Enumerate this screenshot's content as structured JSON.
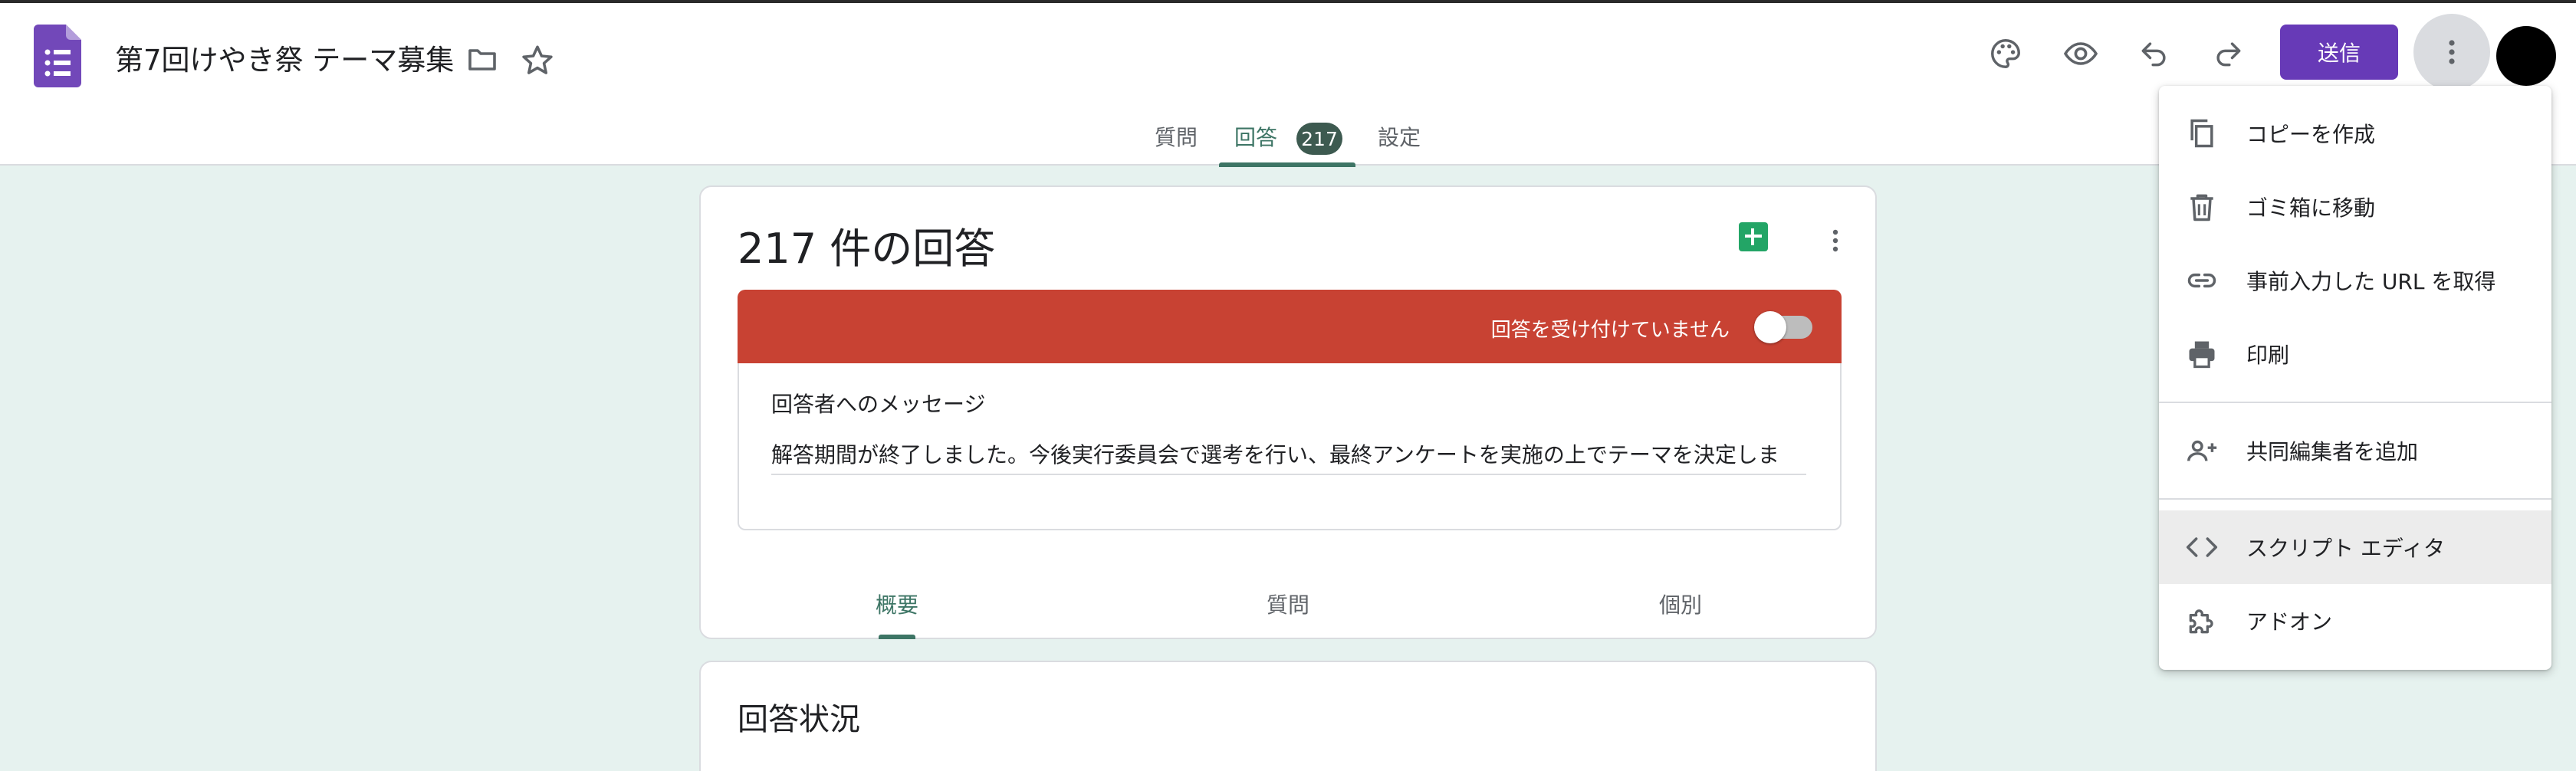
{
  "form": {
    "title": "第7回けやき祭 テーマ募集",
    "send_label": "送信"
  },
  "tabs": {
    "questions": "質問",
    "responses": "回答",
    "responses_badge": "217",
    "settings": "設定"
  },
  "responses_card": {
    "title": "217 件の回答",
    "accepting_label": "回答を受け付けていません",
    "accepting": false,
    "message_label": "回答者へのメッセージ",
    "message_text": "解答期間が終了しました。今後実行委員会で選考を行い、最終アンケートを実施の上でテーマを決定しま",
    "sub_tabs": {
      "summary": "概要",
      "question": "質問",
      "individual": "個別"
    }
  },
  "status_card": {
    "title": "回答状況"
  },
  "menu": {
    "items": [
      {
        "label": "コピーを作成",
        "icon": "copy-icon"
      },
      {
        "label": "ゴミ箱に移動",
        "icon": "trash-icon"
      },
      {
        "label": "事前入力した URL を取得",
        "icon": "link-icon"
      },
      {
        "label": "印刷",
        "icon": "print-icon"
      },
      {
        "label": "共同編集者を追加",
        "icon": "add-collaborator-icon"
      },
      {
        "label": "スクリプト エディタ",
        "icon": "code-icon"
      },
      {
        "label": "アドオン",
        "icon": "puzzle-icon"
      }
    ]
  },
  "colors": {
    "accent": "#673ab7",
    "theme": "#3d7565",
    "background": "#e6f2ef",
    "closed_banner": "#c84233",
    "sheets": "#23a566"
  }
}
